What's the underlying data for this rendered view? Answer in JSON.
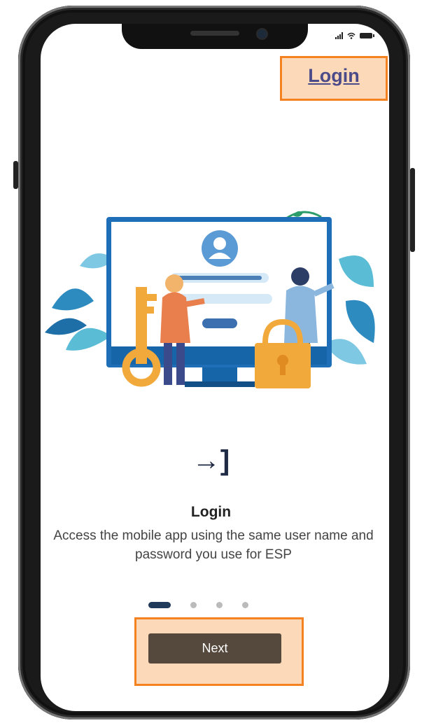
{
  "header": {
    "login_link": "Login"
  },
  "onboarding": {
    "step_icon": "login-arrow-icon",
    "title": "Login",
    "description": "Access the mobile app using the same user name and password you use for ESP",
    "pager": {
      "total": 4,
      "current": 1
    },
    "next_label": "Next"
  },
  "colors": {
    "highlight_fill": "#fcd9b8",
    "highlight_border": "#f58220",
    "next_button": "#55483c",
    "link": "#4c4b8a",
    "active_dot": "#1f3a5a"
  }
}
